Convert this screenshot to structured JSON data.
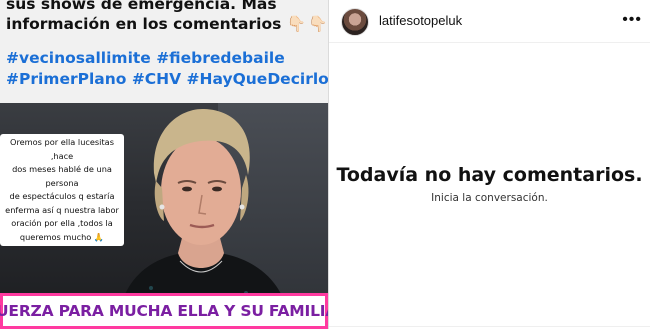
{
  "post": {
    "caption_lines": [
      "sus shows de emergencia. Más",
      "información en los comentarios"
    ],
    "caption_icons": [
      "👇🏻",
      "👇🏻"
    ],
    "hashtag_lines": [
      "#vecinosallimite #fiebredebaile",
      "#PrimerPlano #CHV #HayQueDecirlo"
    ],
    "sticker_lines": [
      "Oremos por ella lucesitas ,hace",
      "dos meses hablé de una persona",
      "de espectáculos q estaría",
      "enferma así q nuestra labor",
      "oración por ella ,todos la",
      "queremos mucho 🙏"
    ],
    "banner_text": "\"FUERZA PARA MUCHA  ELLA Y SU FAMILIA \"",
    "banner_color": "#ff3aa0"
  },
  "panel": {
    "username": "latifesotopeluk",
    "more_icon": "more-options-icon",
    "more_glyph": "•••",
    "empty_title": "Todavía no hay comentarios.",
    "empty_subtitle": "Inicia la conversación."
  },
  "colors": {
    "hashtag": "#1b6fd6",
    "banner_text": "#7b1fa2"
  }
}
